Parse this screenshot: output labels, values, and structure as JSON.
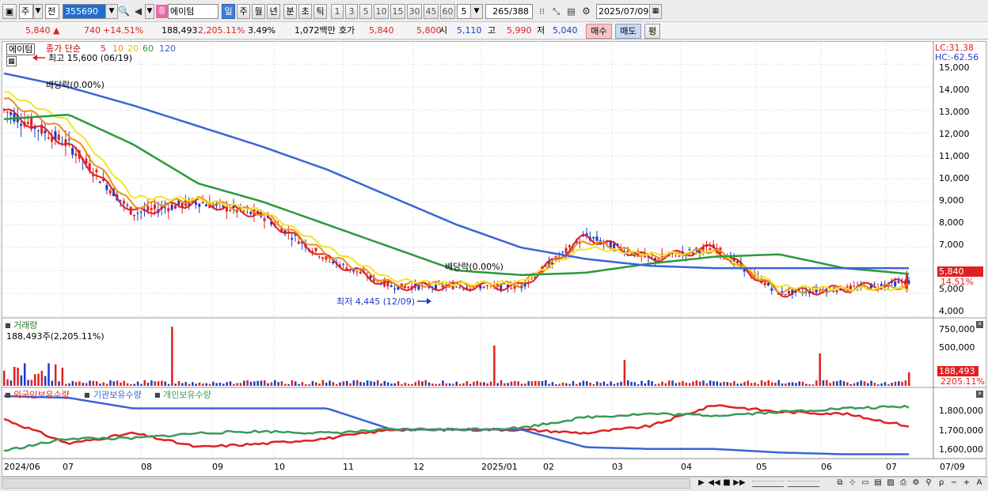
{
  "toolbar": {
    "market": "주",
    "type": "전",
    "code": "355690",
    "stock_name": "에이텀",
    "period_active": "일",
    "periods": [
      "주",
      "월",
      "년",
      "분",
      "초",
      "틱"
    ],
    "intervals": [
      "1",
      "3",
      "5",
      "10",
      "15",
      "30",
      "45",
      "60"
    ],
    "interval_value": "5",
    "count": "265",
    "count_total": "/388",
    "date": "2025/07/09"
  },
  "quote": {
    "price": "5,840",
    "change": "740",
    "change_pct": "+14.51%",
    "volume": "188,493",
    "volume_pct": "2,205.11%",
    "turnover_rate": "3.49%",
    "amount": "1,072백만",
    "ask_label": "호가",
    "ask": "5,840",
    "bid": "5,800",
    "open_label": "시",
    "open": "5,110",
    "high_label": "고",
    "high": "5,990",
    "low_label": "저",
    "low": "5,040",
    "buy_label": "매수",
    "sell_label": "매도",
    "avg_label": "평"
  },
  "price_pane": {
    "name_tag": "에이텀",
    "legend_title": "종가 단순",
    "ma_periods": [
      "5",
      "10",
      "20",
      "60",
      "120"
    ],
    "high_note": "최고 15,600 (06/19)",
    "low_note": "최저 4,445 (12/09)",
    "div_note1": "배당락(0.00%)",
    "div_note2": "배당락(0.00%)",
    "lc": "LC:31.38",
    "hc": "HC:-62.56",
    "current_price": "5,840",
    "current_pct": "14.51%",
    "y_ticks": [
      "15,000",
      "14,000",
      "13,000",
      "12,000",
      "11,000",
      "10,000",
      "9,000",
      "8,000",
      "7,000",
      "6,000",
      "5,000",
      "4,000"
    ]
  },
  "volume_pane": {
    "title": "거래량",
    "info": "188,493주(2,205.11%)",
    "y_ticks": [
      "750,000",
      "500,000",
      "250,000"
    ],
    "current": "188,493",
    "current_pct": "2205.11%"
  },
  "holding_pane": {
    "legend": [
      "외국인보유수량",
      "기관보유수량",
      "개인보유수량"
    ],
    "y_ticks": [
      "1,800,000",
      "1,700,000",
      "1,600,000"
    ]
  },
  "x_axis": [
    "2024/06",
    "07",
    "08",
    "09",
    "10",
    "11",
    "12",
    "2025/01",
    "02",
    "03",
    "04",
    "05",
    "06",
    "07",
    "07/09"
  ],
  "colors": {
    "up": "#e02020",
    "down": "#1a3cc8",
    "ma5": "#e02020",
    "ma10": "#f08c1e",
    "ma20": "#f0e628",
    "ma60": "#2a9a3a",
    "ma120": "#3a64d8",
    "foreign": "#e02020",
    "institution": "#3a64d8",
    "individual": "#3a9a5a"
  },
  "chart_data": [
    {
      "type": "line",
      "name": "price",
      "x": [
        "2024/06",
        "07",
        "08",
        "09",
        "10",
        "11",
        "12",
        "2025/01",
        "02",
        "03",
        "04",
        "05",
        "06",
        "07",
        "07/09"
      ],
      "series": [
        {
          "name": "5",
          "values": [
            13000,
            11500,
            8500,
            9000,
            8400,
            6500,
            5300,
            5300,
            5300,
            7500,
            6500,
            7000,
            5000,
            5200,
            5500
          ]
        },
        {
          "name": "10",
          "values": [
            13500,
            12000,
            8800,
            9100,
            8500,
            6700,
            5400,
            5400,
            5400,
            7300,
            6600,
            6900,
            5100,
            5200,
            5300
          ]
        },
        {
          "name": "20",
          "values": [
            13800,
            12500,
            9200,
            9100,
            8600,
            7000,
            5600,
            5400,
            5500,
            7000,
            6700,
            6800,
            5300,
            5200,
            5200
          ]
        },
        {
          "name": "60",
          "values": [
            12600,
            12800,
            11500,
            9800,
            9000,
            8000,
            7000,
            6000,
            5800,
            5900,
            6300,
            6600,
            6700,
            6100,
            5850
          ]
        },
        {
          "name": "120",
          "values": [
            14600,
            14000,
            13200,
            12300,
            11400,
            10400,
            9200,
            8000,
            7000,
            6500,
            6200,
            6100,
            6100,
            6100,
            6100
          ]
        }
      ],
      "ylim": [
        4000,
        15800
      ],
      "annotations": [
        "최고 15,600 (06/19)",
        "최저 4,445 (12/09)"
      ]
    },
    {
      "type": "bar",
      "name": "거래량",
      "ylim": [
        0,
        900000
      ],
      "peaks": [
        {
          "x": "2024/06",
          "value": 420000
        },
        {
          "x": "08",
          "value": 820000
        },
        {
          "x": "2025/01",
          "value": 560000
        },
        {
          "x": "03",
          "value": 360000
        },
        {
          "x": "06",
          "value": 450000
        },
        {
          "x": "07/09",
          "value": 188493
        }
      ]
    },
    {
      "type": "line",
      "name": "holdings",
      "ylim": [
        1540000,
        1930000
      ],
      "series": [
        {
          "name": "외국인보유수량",
          "values": [
            1760000,
            1620000,
            1680000,
            1600000,
            1620000,
            1650000,
            1700000,
            1700000,
            1700000,
            1680000,
            1720000,
            1840000,
            1800000,
            1790000,
            1720000
          ]
        },
        {
          "name": "기관보유수량",
          "values": [
            1890000,
            1880000,
            1820000,
            1820000,
            1820000,
            1820000,
            1700000,
            1700000,
            1700000,
            1600000,
            1590000,
            1590000,
            1570000,
            1560000,
            1560000
          ]
        },
        {
          "name": "개인보유수량",
          "values": [
            1580000,
            1650000,
            1650000,
            1680000,
            1690000,
            1680000,
            1700000,
            1700000,
            1710000,
            1770000,
            1790000,
            1780000,
            1800000,
            1820000,
            1830000
          ]
        }
      ]
    }
  ]
}
